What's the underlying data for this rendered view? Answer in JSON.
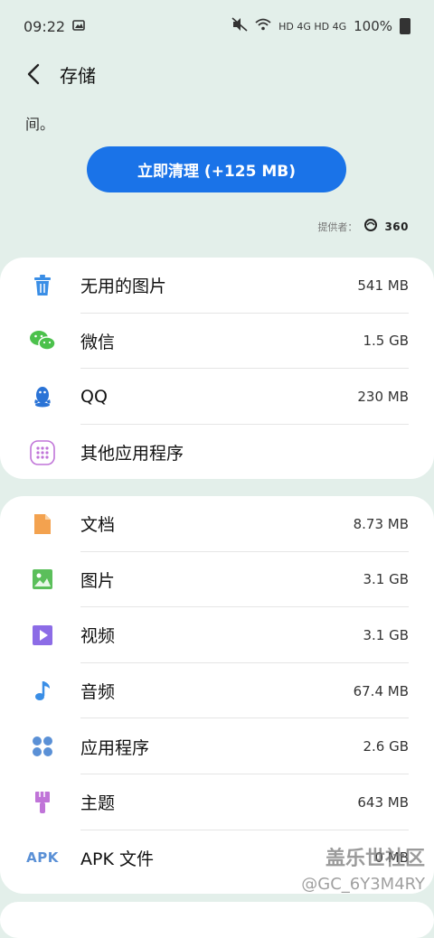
{
  "status_bar": {
    "time": "09:22",
    "signal_text": "HD 4G HD 4G",
    "battery": "100%"
  },
  "header": {
    "title": "存储"
  },
  "snippet": "间。",
  "clean_button": {
    "label": "立即清理 (+125 MB)"
  },
  "provider": {
    "prefix": "提供者：",
    "name": "360"
  },
  "cleanup_list": [
    {
      "label": "无用的图片",
      "size": "541 MB",
      "icon": "trash-icon",
      "color": "#3a8ee6"
    },
    {
      "label": "微信",
      "size": "1.5 GB",
      "icon": "wechat-icon",
      "color": "#4cc14c"
    },
    {
      "label": "QQ",
      "size": "230 MB",
      "icon": "qq-icon",
      "color": "#2a73d6"
    },
    {
      "label": "其他应用程序",
      "size": "",
      "icon": "apps-grid-icon",
      "color": "#c074d8"
    }
  ],
  "category_list": [
    {
      "label": "文档",
      "size": "8.73 MB",
      "icon": "document-icon",
      "color": "#f3a24f"
    },
    {
      "label": "图片",
      "size": "3.1 GB",
      "icon": "image-icon",
      "color": "#5bbf5b"
    },
    {
      "label": "视频",
      "size": "3.1 GB",
      "icon": "video-icon",
      "color": "#8c6ce6"
    },
    {
      "label": "音频",
      "size": "67.4 MB",
      "icon": "music-icon",
      "color": "#3a8ee6"
    },
    {
      "label": "应用程序",
      "size": "2.6 GB",
      "icon": "apps-icon",
      "color": "#5a90d6"
    },
    {
      "label": "主题",
      "size": "643 MB",
      "icon": "brush-icon",
      "color": "#c074d8"
    },
    {
      "label": "APK 文件",
      "size": "0 MB",
      "icon": "apk-icon",
      "color": "#5a90d6"
    }
  ],
  "apk_icon_text": "APK",
  "watermark": {
    "line1": "盖乐世社区",
    "line2": "@GC_6Y3M4RY"
  }
}
